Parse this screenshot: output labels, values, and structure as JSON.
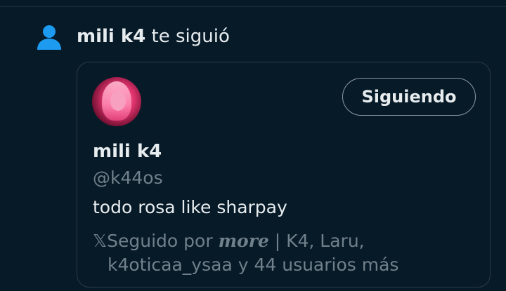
{
  "notification": {
    "icon": "person-icon",
    "icon_color": "#1d9bf0",
    "actor_name": "mili k4",
    "action_text": "te siguió"
  },
  "user_card": {
    "avatar": "profile-avatar",
    "follow_button_label": "Siguiendo",
    "display_name": "mili k4",
    "handle": "@k44os",
    "bio": "todo rosa like sharpay",
    "followed_by": {
      "prefix": "𝕏Seguido por ",
      "styled_name": "more",
      "rest_line1": " | K4, Laru,",
      "line2": "k4oticaa_ysaa y 44 usuarios más"
    }
  },
  "colors": {
    "background": "#071a27",
    "primary_text": "#e7ecef",
    "secondary_text": "#71818b",
    "card_border": "#2a3b47",
    "accent": "#1d9bf0"
  }
}
